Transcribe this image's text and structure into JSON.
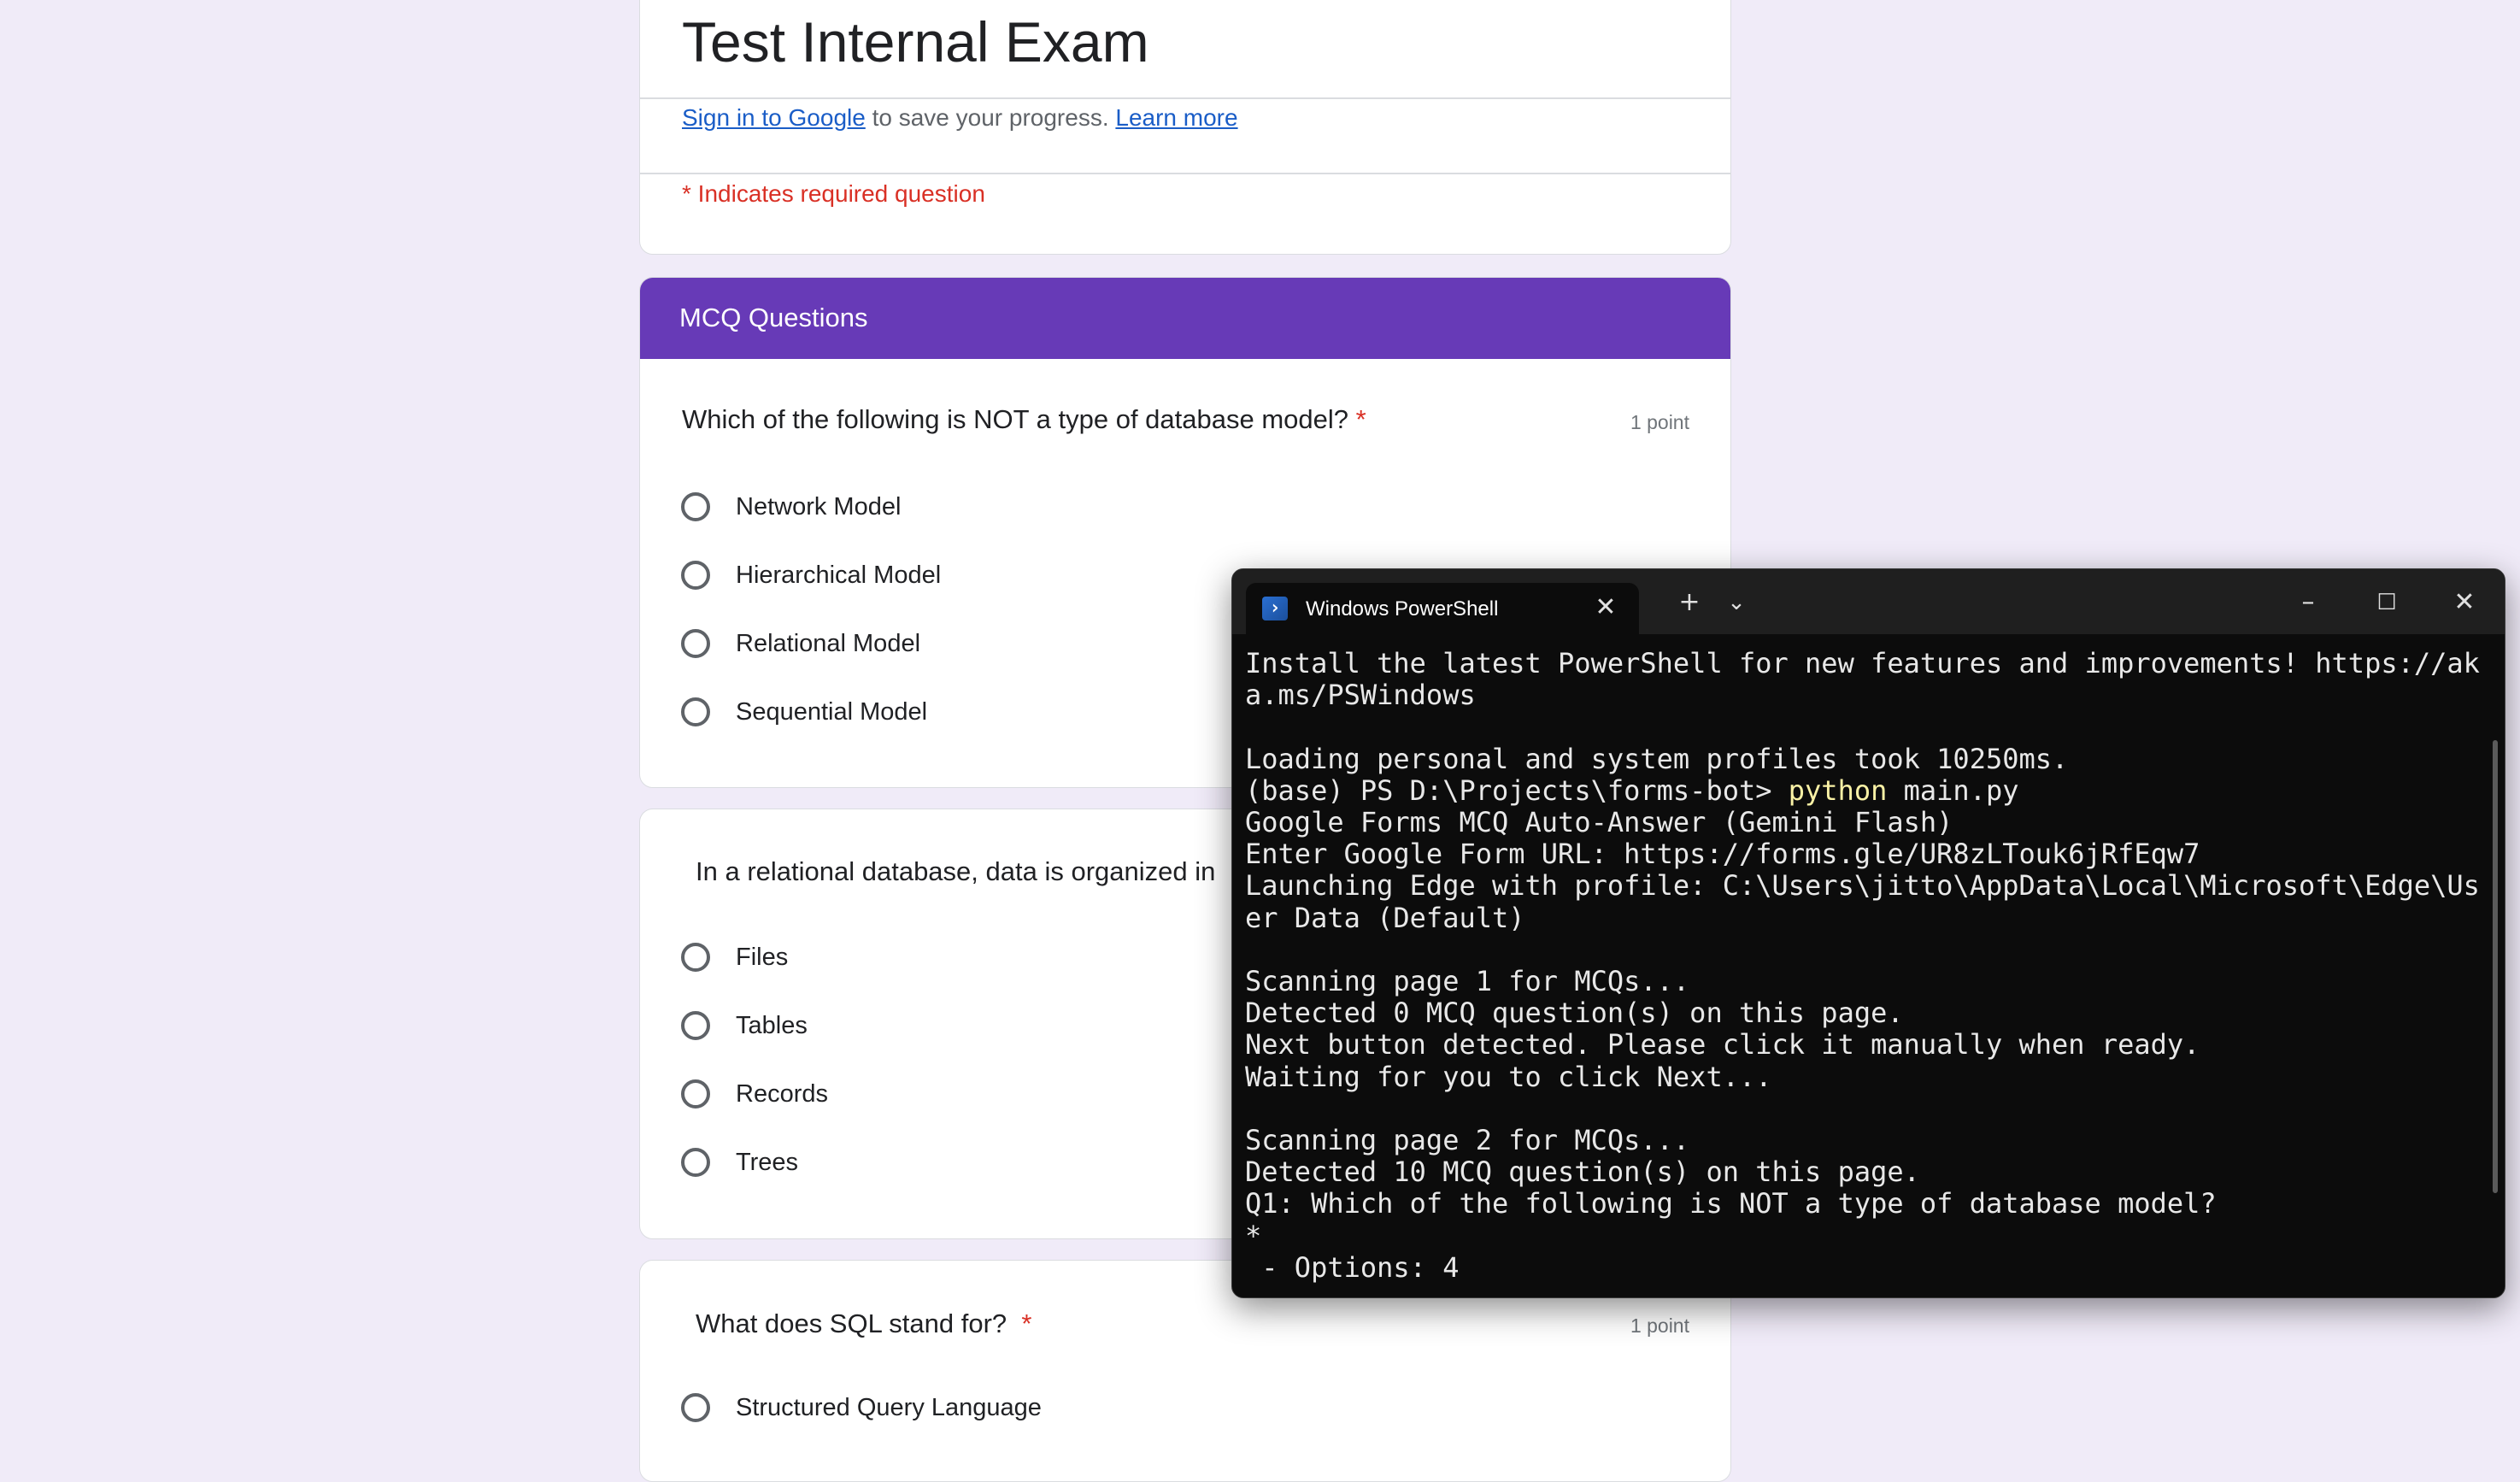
{
  "form": {
    "title": "Test Internal Exam",
    "signin_link": "Sign in to Google",
    "signin_rest": " to save your progress. ",
    "learn_more": "Learn more",
    "required_note": "* Indicates required question",
    "section_title": "MCQ Questions",
    "questions": [
      {
        "text": "Which of the following is NOT a type of database model?",
        "required_mark": "*",
        "points": "1 point",
        "options": [
          "Network Model",
          "Hierarchical Model",
          "Relational Model",
          "Sequential Model"
        ]
      },
      {
        "text": "In a relational database, data is organized in",
        "options": [
          "Files",
          "Tables",
          "Records",
          "Trees"
        ]
      },
      {
        "text": "What does SQL stand for?",
        "required_mark": "*",
        "points": "1 point",
        "options": [
          "Structured Query Language"
        ]
      }
    ]
  },
  "terminal": {
    "tab_title": "Windows PowerShell",
    "icons": {
      "tab_close": "close-icon",
      "new_tab": "plus-icon",
      "dropdown": "chevron-down-icon",
      "minimize": "minimize-icon",
      "maximize": "maximize-icon",
      "close": "close-icon"
    },
    "lines": [
      "Install the latest PowerShell for new features and improvements! https://ak",
      "a.ms/PSWindows",
      "",
      "Loading personal and system profiles took 10250ms.",
      "",
      "Google Forms MCQ Auto-Answer (Gemini Flash)",
      "Enter Google Form URL: https://forms.gle/UR8zLTouk6jRfEqw7",
      "Launching Edge with profile: C:\\Users\\jitto\\AppData\\Local\\Microsoft\\Edge\\Us",
      "er Data (Default)",
      "",
      "Scanning page 1 for MCQs...",
      "Detected 0 MCQ question(s) on this page.",
      "Next button detected. Please click it manually when ready.",
      "Waiting for you to click Next...",
      "",
      "Scanning page 2 for MCQs...",
      "Detected 10 MCQ question(s) on this page.",
      "Q1: Which of the following is NOT a type of database model?",
      "*",
      " - Options: 4"
    ],
    "prompt": "(base) PS D:\\Projects\\forms-bot> ",
    "prompt_cmd": "python",
    "prompt_args": " main.py"
  },
  "colors": {
    "page_bg": "#f0ebf8",
    "section_banner": "#673ab7",
    "required": "#d93025",
    "link": "#1a5dc7",
    "terminal_bg": "#0c0c0c",
    "terminal_cmd": "#f9f1a5"
  }
}
